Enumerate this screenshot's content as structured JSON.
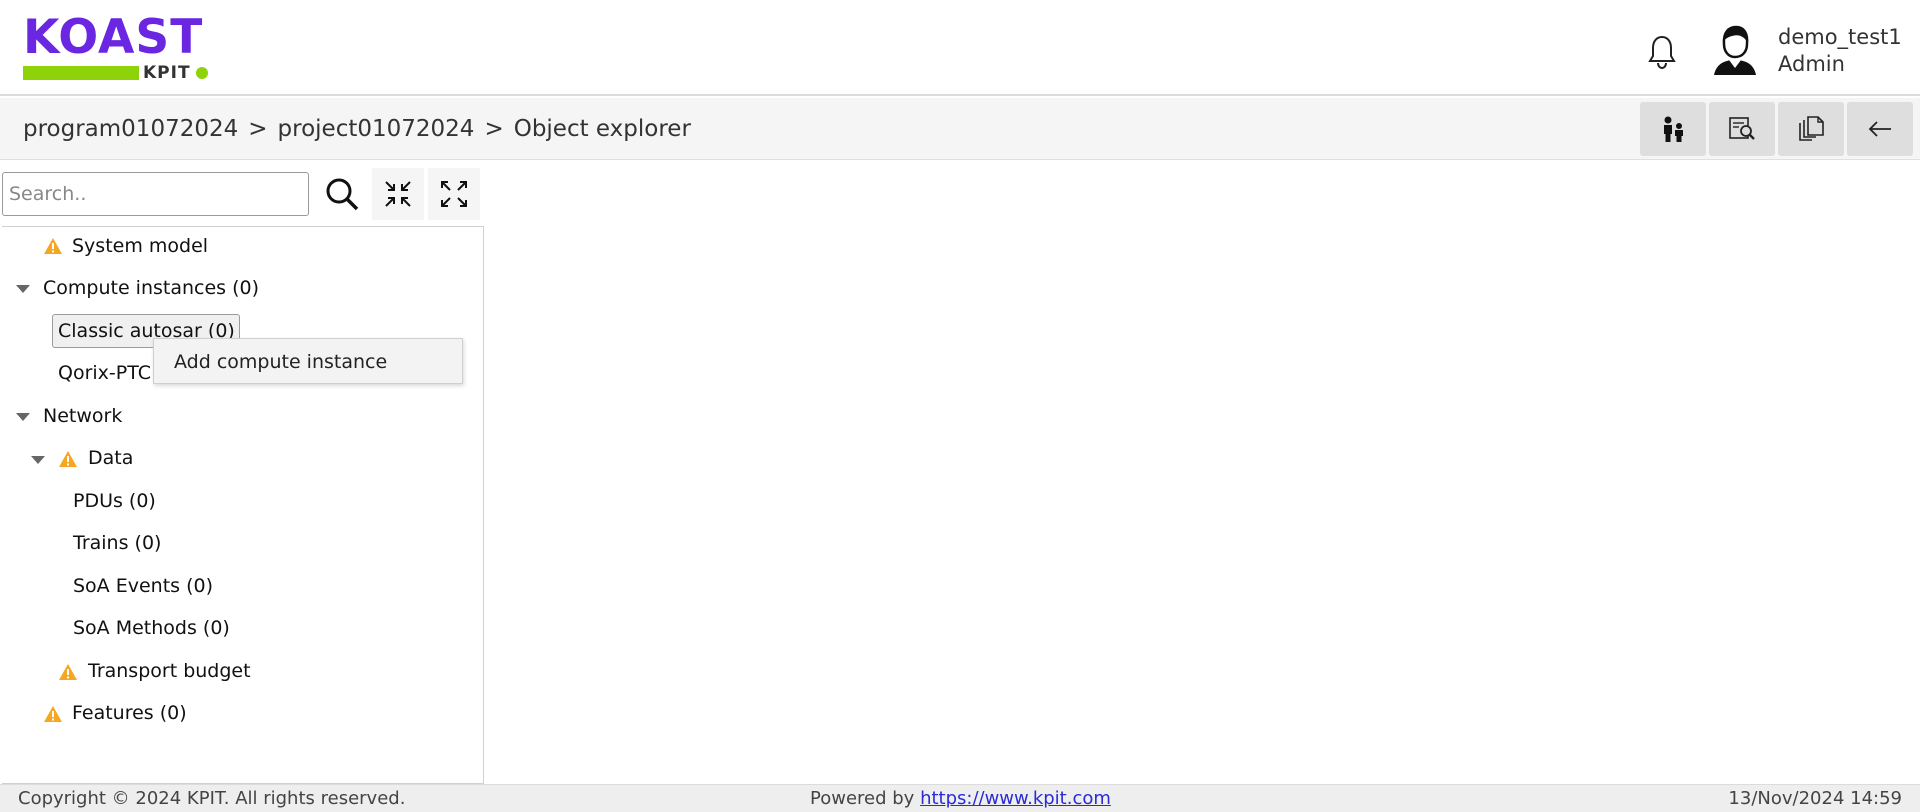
{
  "header": {
    "logo_word": "KOAST",
    "logo_sub": "KPIT",
    "user_name": "demo_test1",
    "user_role": "Admin",
    "icons": [
      "bell-icon",
      "user-avatar-icon"
    ]
  },
  "breadcrumb": {
    "items": [
      "program01072024",
      "project01072024",
      "Object explorer"
    ],
    "separator": ">"
  },
  "toolbar": {
    "buttons": [
      "people-icon",
      "search-document-icon",
      "copy-pages-icon",
      "back-arrow-icon"
    ]
  },
  "search": {
    "placeholder": "Search..",
    "value": ""
  },
  "tree": {
    "items": [
      {
        "label": "System model",
        "warning": true
      },
      {
        "label": "Compute instances (0)",
        "expanded": true
      },
      {
        "label": "Classic autosar (0)",
        "selected": true
      },
      {
        "label": "Qorix-PTC"
      },
      {
        "label": "Network",
        "expanded": true
      },
      {
        "label": "Data",
        "warning": true,
        "expanded": true
      },
      {
        "label": "PDUs (0)"
      },
      {
        "label": "Trains (0)"
      },
      {
        "label": "SoA Events (0)"
      },
      {
        "label": "SoA Methods (0)"
      },
      {
        "label": "Transport budget",
        "warning": true
      },
      {
        "label": "Features (0)",
        "warning": true
      }
    ]
  },
  "context_menu": {
    "items": [
      "Add compute instance"
    ]
  },
  "footer": {
    "copyright": "Copyright © 2024 KPIT. All rights reserved.",
    "powered_prefix": "Powered by",
    "powered_link": "https://www.kpit.com",
    "datetime": "13/Nov/2024 14:59"
  },
  "colors": {
    "brand_purple": "#6a26e0",
    "brand_green": "#8ed30a",
    "warning": "#f5a623",
    "link": "#2a2ad8"
  }
}
